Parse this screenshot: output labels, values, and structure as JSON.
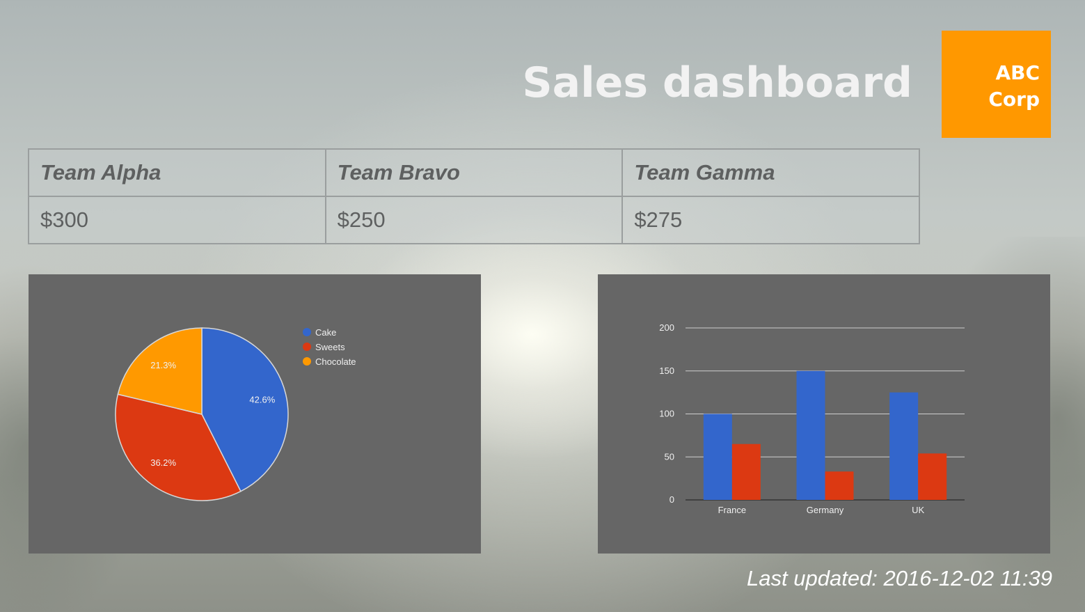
{
  "header": {
    "title": "Sales dashboard",
    "logo_line1": "ABC",
    "logo_line2": "Corp",
    "logo_color": "#ff9800"
  },
  "teams": {
    "headers": [
      "Team Alpha",
      "Team Bravo",
      "Team Gamma"
    ],
    "values": [
      "$300",
      "$250",
      "$275"
    ]
  },
  "chart_data": [
    {
      "type": "pie",
      "slices": [
        {
          "name": "Cake",
          "value": 42.6,
          "label": "42.6%",
          "color": "#3366cc"
        },
        {
          "name": "Sweets",
          "value": 36.2,
          "label": "36.2%",
          "color": "#dc3912"
        },
        {
          "name": "Chocolate",
          "value": 21.3,
          "label": "21.3%",
          "color": "#ff9900"
        }
      ],
      "legend_position": "right"
    },
    {
      "type": "bar",
      "categories": [
        "France",
        "Germany",
        "UK"
      ],
      "series": [
        {
          "values": [
            100,
            150,
            125
          ],
          "color": "#3366cc"
        },
        {
          "values": [
            65,
            33,
            54
          ],
          "color": "#dc3912"
        }
      ],
      "ylim": [
        0,
        200
      ],
      "yticks": [
        0,
        50,
        100,
        150,
        200
      ],
      "grid": true
    }
  ],
  "footer": {
    "last_updated": "Last updated: 2016-12-02 11:39"
  }
}
